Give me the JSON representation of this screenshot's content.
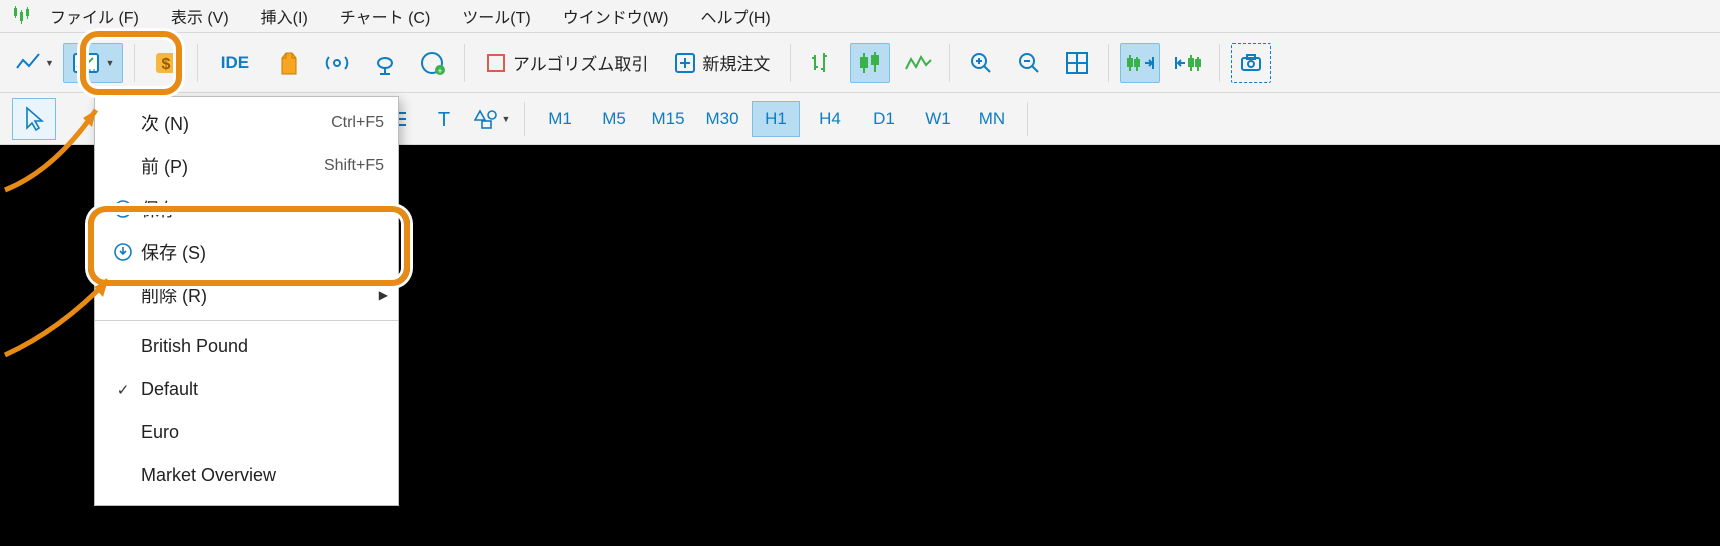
{
  "menu": {
    "items": [
      "ファイル (F)",
      "表示 (V)",
      "挿入(I)",
      "チャート (C)",
      "ツール(T)",
      "ウインドウ(W)",
      "ヘルプ(H)"
    ]
  },
  "toolbar": {
    "ide": "IDE",
    "algo": "アルゴリズム取引",
    "neworder": "新規注文"
  },
  "timeframes": [
    "M1",
    "M5",
    "M15",
    "M30",
    "H1",
    "H4",
    "D1",
    "W1",
    "MN"
  ],
  "active_tf": "H1",
  "dropdown": {
    "next": {
      "label": "次 (N)",
      "accel": "Ctrl+F5"
    },
    "prev": {
      "label": "前 (P)",
      "accel": "Shift+F5"
    },
    "save0": {
      "label": "保存"
    },
    "save": {
      "label": "保存 (S)"
    },
    "delete": {
      "label": "削除 (R)"
    },
    "presets": [
      "British Pound",
      "Default",
      "Euro",
      "Market Overview"
    ],
    "checked": "Default"
  }
}
